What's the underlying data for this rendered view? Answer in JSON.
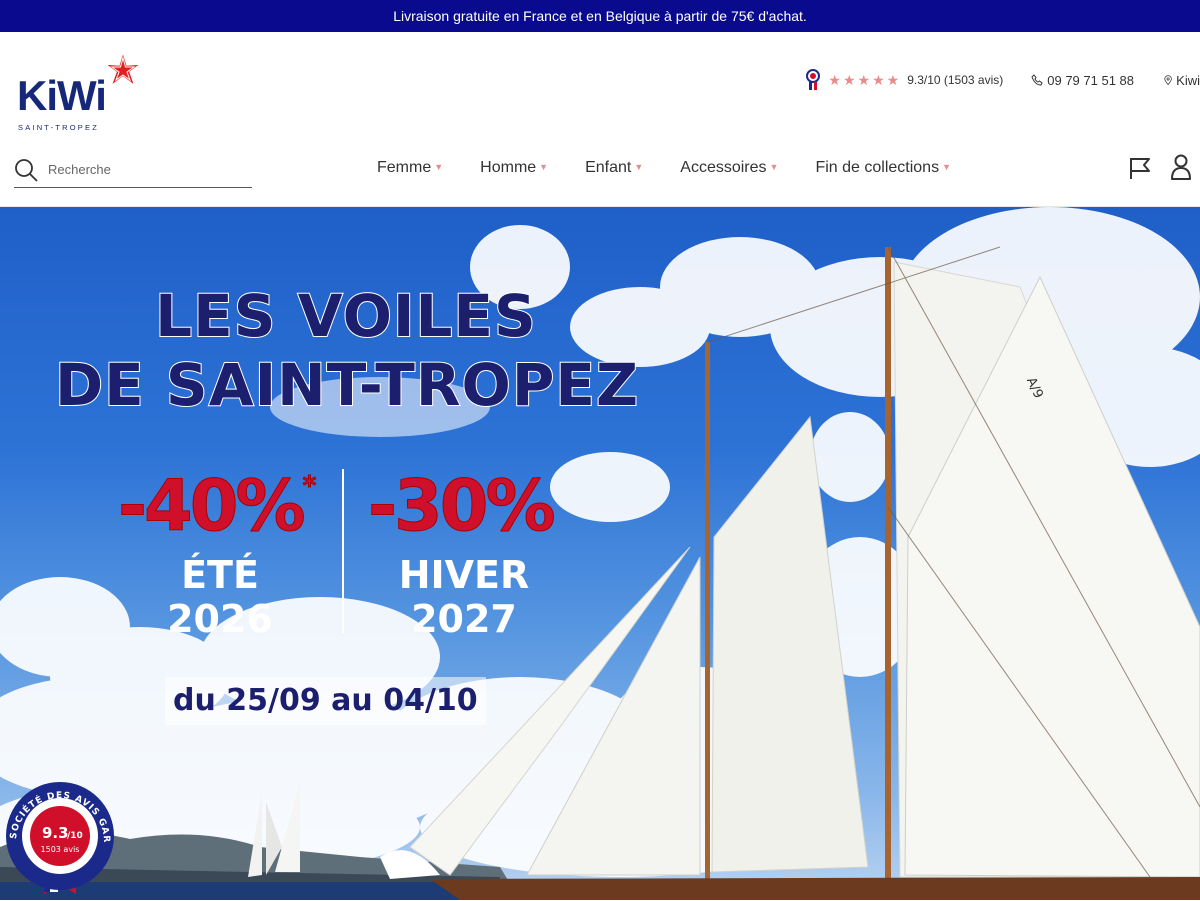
{
  "topbar": {
    "text": "Livraison gratuite en France et en Belgique à partir de 75€ d'achat."
  },
  "logo": {
    "name": "KiWi",
    "tagline": "SAINT-TROPEZ"
  },
  "header": {
    "rating": {
      "stars": "★★★★★",
      "score": "9.3/10 (1503 avis)"
    },
    "phone": "09 79 71 51 88",
    "store_label": "Kiwi"
  },
  "search": {
    "placeholder": "Recherche"
  },
  "nav": {
    "items": [
      {
        "label": "Femme"
      },
      {
        "label": "Homme"
      },
      {
        "label": "Enfant"
      },
      {
        "label": "Accessoires"
      },
      {
        "label": "Fin de collections"
      }
    ]
  },
  "hero": {
    "title_line1": "LES VOILES",
    "title_line2": "DE SAINT-TROPEZ",
    "discount1": "-40%",
    "discount1_mark": "*",
    "discount2": "-30%",
    "season1_line1": "ÉTÉ",
    "season1_line2": "2026",
    "season2_line1": "HIVER",
    "season2_line2": "2027",
    "dates": "du 25/09 au 04/10"
  },
  "sag_badge": {
    "ring_text": "SOCIÉTÉ DES AVIS GARANTIS",
    "score": "9.3",
    "score_suffix": "/10",
    "count": "1503 avis"
  },
  "colors": {
    "topbar": "#0a0a8e",
    "brand_navy": "#16287a",
    "accent_pink": "#e88b8b",
    "promo_red": "#d0102a"
  }
}
